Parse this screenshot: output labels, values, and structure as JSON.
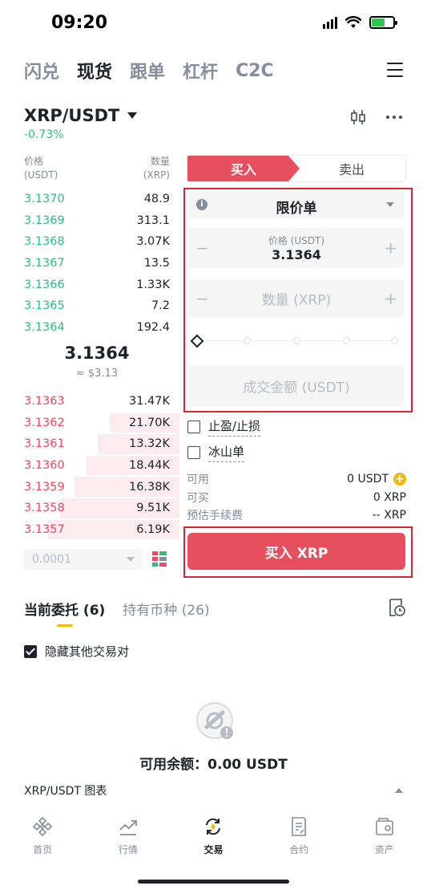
{
  "status": {
    "time": "09:20"
  },
  "top_tabs": [
    {
      "label": "闪兑",
      "active": false
    },
    {
      "label": "现货",
      "active": true
    },
    {
      "label": "跟单",
      "active": false
    },
    {
      "label": "杠杆",
      "active": false
    },
    {
      "label": "C2C",
      "active": false
    }
  ],
  "pair": {
    "symbol": "XRP/USDT",
    "change": "-0.73%"
  },
  "orderbook": {
    "price_header": "价格",
    "price_unit": "(USDT)",
    "qty_header": "数量",
    "qty_unit": "(XRP)",
    "buys": [
      {
        "price": "3.1370",
        "qty": "48.9"
      },
      {
        "price": "3.1369",
        "qty": "313.1"
      },
      {
        "price": "3.1368",
        "qty": "3.07K"
      },
      {
        "price": "3.1367",
        "qty": "13.5"
      },
      {
        "price": "3.1366",
        "qty": "1.33K"
      },
      {
        "price": "3.1365",
        "qty": "7.2"
      },
      {
        "price": "3.1364",
        "qty": "192.4"
      }
    ],
    "mid_price": "3.1364",
    "mid_usd": "≈ $3.13",
    "sells": [
      {
        "price": "3.1363",
        "qty": "31.47K",
        "depth": 0
      },
      {
        "price": "3.1362",
        "qty": "21.70K",
        "depth": 0.48
      },
      {
        "price": "3.1361",
        "qty": "13.32K",
        "depth": 0.56
      },
      {
        "price": "3.1360",
        "qty": "18.44K",
        "depth": 0.64
      },
      {
        "price": "3.1359",
        "qty": "16.38K",
        "depth": 0.72
      },
      {
        "price": "3.1358",
        "qty": "9.51K",
        "depth": 0.82
      },
      {
        "price": "3.1357",
        "qty": "6.19K",
        "depth": 0.9
      }
    ],
    "precision": "0.0001"
  },
  "trade": {
    "buy_tab": "买入",
    "sell_tab": "卖出",
    "order_type": "限价单",
    "price_label": "价格 (USDT)",
    "price_value": "3.1364",
    "qty_placeholder": "数量 (XRP)",
    "total_placeholder": "成交金额 (USDT)",
    "tpsl_label": "止盈/止损",
    "iceberg_label": "冰山单",
    "available_label": "可用",
    "available_value": "0 USDT",
    "can_buy_label": "可买",
    "can_buy_value": "0 XRP",
    "fee_label": "预估手续费",
    "fee_value": "-- XRP",
    "buy_button": "买入 XRP"
  },
  "orders": {
    "tab_current": "当前委托 (6)",
    "tab_holdings": "持有币种 (26)",
    "hide_others": "隐藏其他交易对",
    "empty_text": "可用余额：0.00 USDT"
  },
  "chart_bar": {
    "label": "XRP/USDT 图表"
  },
  "bottom_nav": [
    {
      "label": "首页",
      "icon": "home-icon"
    },
    {
      "label": "行情",
      "icon": "markets-icon"
    },
    {
      "label": "交易",
      "icon": "trade-icon"
    },
    {
      "label": "合约",
      "icon": "futures-icon"
    },
    {
      "label": "资产",
      "icon": "wallet-icon"
    }
  ],
  "colors": {
    "buy_green": "#2ebd85",
    "sell_red": "#f6465d",
    "buy_button": "#e6505e",
    "accent_yellow": "#f0b90b",
    "highlight_box": "#d9262e"
  }
}
